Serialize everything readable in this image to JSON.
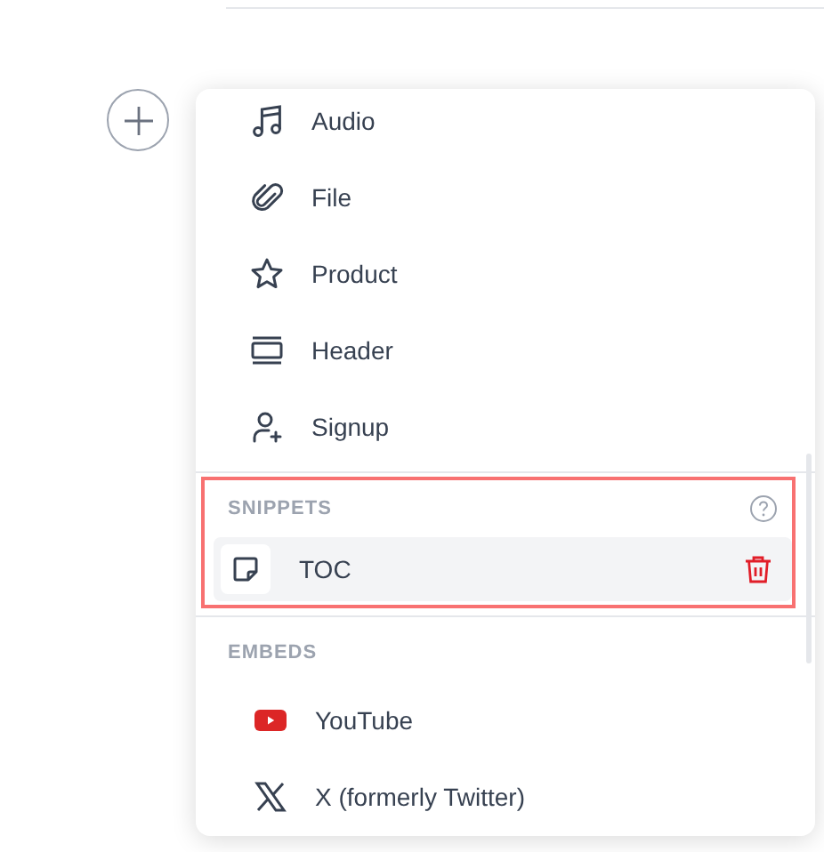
{
  "blocks": {
    "items": [
      {
        "label": "Audio"
      },
      {
        "label": "File"
      },
      {
        "label": "Product"
      },
      {
        "label": "Header"
      },
      {
        "label": "Signup"
      }
    ]
  },
  "snippets": {
    "heading": "SNIPPETS",
    "highlighted": true,
    "items": [
      {
        "label": "TOC",
        "selected": true
      }
    ]
  },
  "embeds": {
    "heading": "EMBEDS",
    "items": [
      {
        "label": "YouTube"
      },
      {
        "label": "X (formerly Twitter)"
      }
    ]
  }
}
